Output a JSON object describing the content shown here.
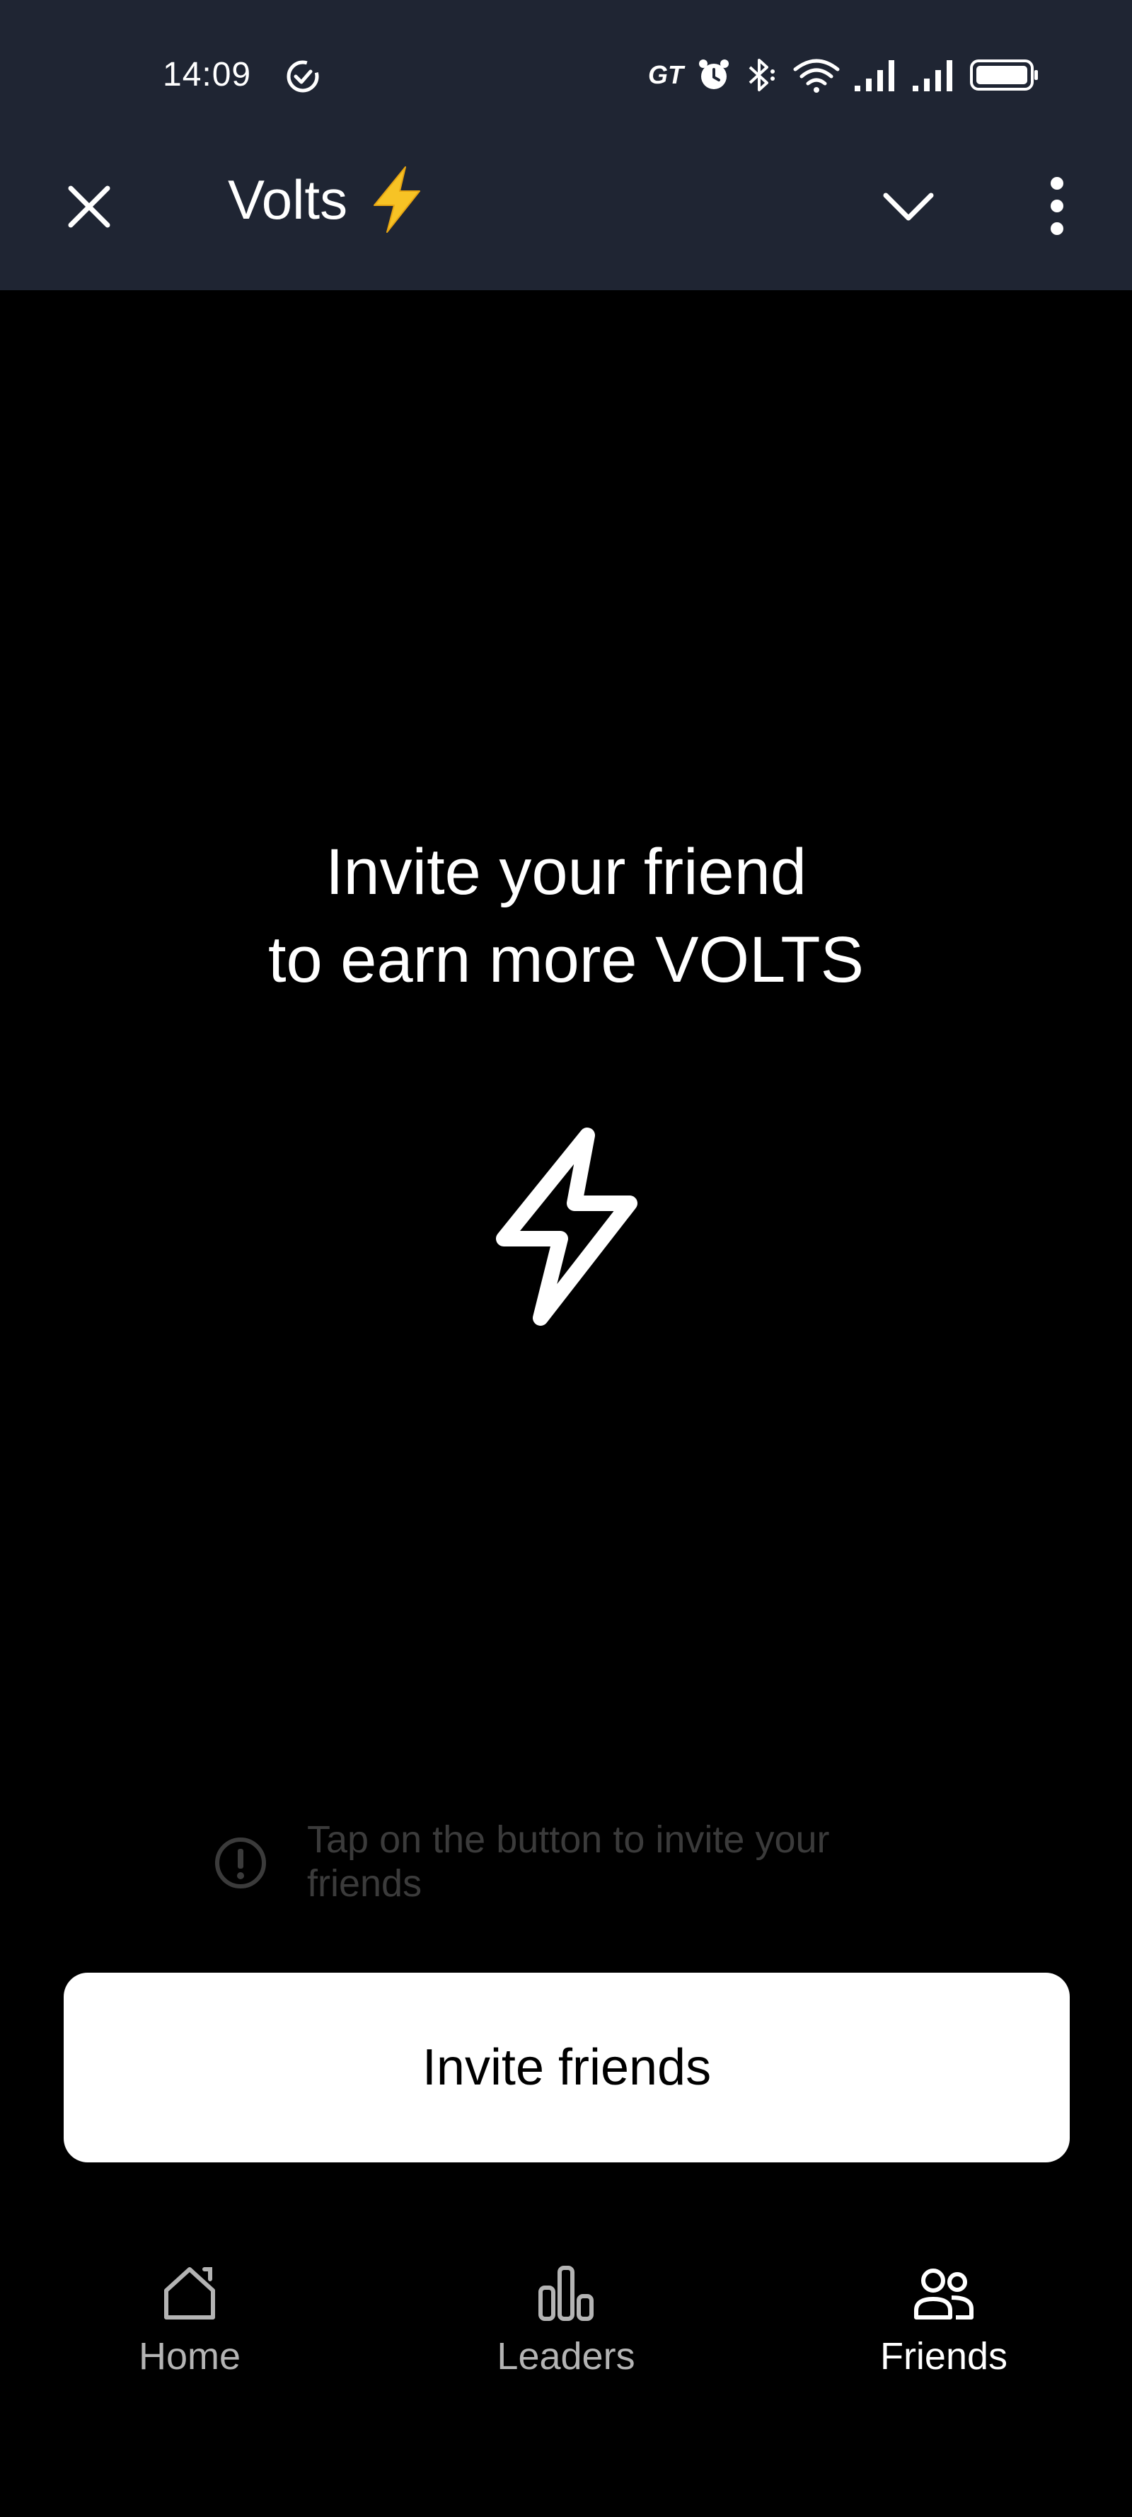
{
  "status_bar": {
    "time": "14:09",
    "carrier_label": "GT"
  },
  "header": {
    "title": "Volts",
    "icons": [
      "close-icon",
      "lightning-emoji-icon",
      "chevron-down-icon",
      "more-vertical-icon"
    ]
  },
  "main": {
    "headline_line1": "Invite your friend",
    "headline_line2": "to earn more VOLTS",
    "hint_text": "Tap on the button to invite your friends",
    "invite_button_label": "Invite friends"
  },
  "nav": {
    "items": [
      {
        "label": "Home",
        "icon": "home-icon",
        "active": false
      },
      {
        "label": "Leaders",
        "icon": "bar-chart-icon",
        "active": false
      },
      {
        "label": "Friends",
        "icon": "friends-icon",
        "active": true
      }
    ]
  },
  "colors": {
    "header_bg": "#1f2533",
    "page_bg": "#000000",
    "button_bg": "#ffffff",
    "hint_text": "#3b3b3b",
    "lightning_yellow": "#f7c325"
  }
}
